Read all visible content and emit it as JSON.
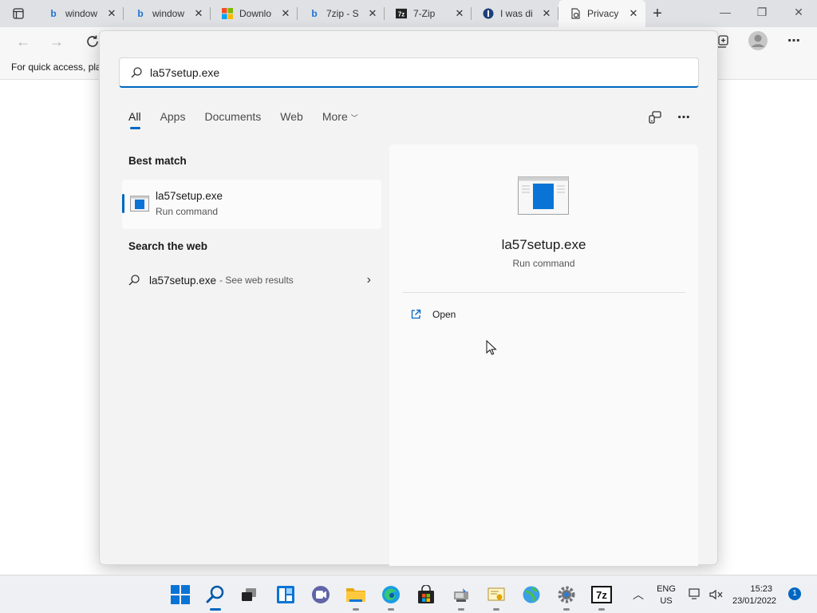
{
  "browser": {
    "tabs": [
      {
        "title": "window",
        "favicon": "bing-icon"
      },
      {
        "title": "window",
        "favicon": "bing-icon"
      },
      {
        "title": "Downlo",
        "favicon": "microsoft-icon"
      },
      {
        "title": "7zip - S",
        "favicon": "bing-icon"
      },
      {
        "title": "7-Zip",
        "favicon": "7zip-icon"
      },
      {
        "title": "I was di",
        "favicon": "site-icon"
      },
      {
        "title": "Privacy",
        "favicon": "privacy-icon"
      }
    ],
    "favorites_hint": "For quick access, pla"
  },
  "search": {
    "query": "la57setup.exe",
    "filters": [
      "All",
      "Apps",
      "Documents",
      "Web",
      "More"
    ],
    "best_match_title": "Best match",
    "best_match": {
      "name": "la57setup.exe",
      "type": "Run command"
    },
    "web_title": "Search the web",
    "web_result": {
      "query": "la57setup.exe",
      "suffix": "- See web results"
    },
    "preview": {
      "name": "la57setup.exe",
      "type": "Run command",
      "action": "Open"
    }
  },
  "taskbar": {
    "lang_line1": "ENG",
    "lang_line2": "US",
    "time": "15:23",
    "date": "23/01/2022",
    "notifications": "1"
  },
  "colors": {
    "accent": "#0067c0"
  }
}
